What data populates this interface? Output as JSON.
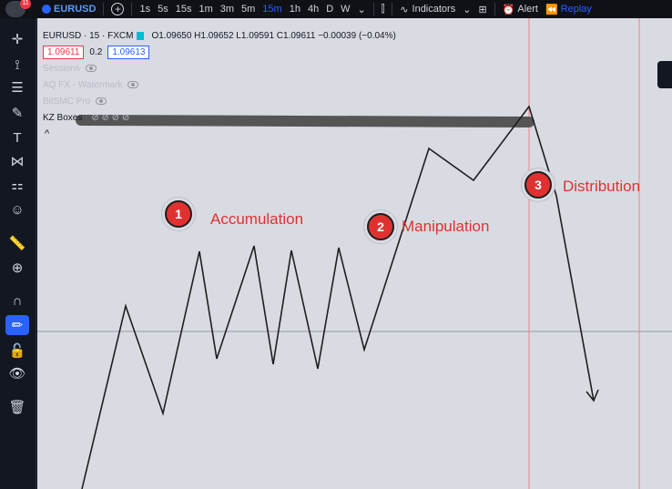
{
  "topbar": {
    "badge": "11",
    "symbol": "EURUSD",
    "add": "+",
    "intervals": [
      "1s",
      "5s",
      "15s",
      "1m",
      "3m",
      "5m",
      "15m",
      "1h",
      "4h",
      "D",
      "W"
    ],
    "active_interval": "15m",
    "indicators_label": "Indicators",
    "alert_label": "Alert",
    "replay_label": "Replay"
  },
  "legend": {
    "title": "EURUSD · 15 · FXCM",
    "ohlc": "O1.09650  H1.09652  L1.09591  C1.09611  −0.00039 (−0.04%)",
    "bid": "1.09611",
    "spread": "0.2",
    "ask": "1.09613",
    "indicators": [
      "Sessions",
      "AQ FX - Watermark",
      "BitSMC Pro",
      "KZ Boxes"
    ],
    "kz_values": "⊘ ⊘ ⊘ ⊘",
    "collapse": "^"
  },
  "annotations": {
    "phases": [
      {
        "number": "1",
        "label": "Accumulation"
      },
      {
        "number": "2",
        "label": "Manipulation"
      },
      {
        "number": "3",
        "label": "Distribution"
      }
    ],
    "colors": {
      "accent": "#e03131",
      "line": "#1e1e1e",
      "vline": "#f08080"
    }
  },
  "left_toolbar": {
    "icons": [
      "crosshair-icon",
      "cursor-icon",
      "trend-lines-icon",
      "brush-icon",
      "text-icon",
      "pattern-icon",
      "measure-forecast-icon",
      "emoji-icon",
      "ruler-icon",
      "zoom-in-icon",
      "magnet-icon",
      "lock-drawing-icon",
      "lock-icon",
      "eye-icon",
      "trash-icon"
    ]
  }
}
